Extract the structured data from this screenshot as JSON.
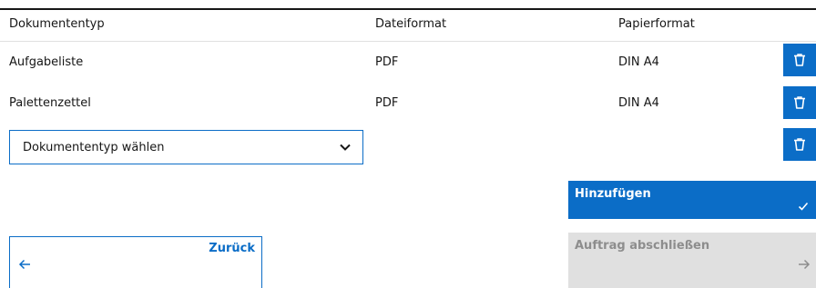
{
  "table": {
    "headers": [
      "Dokumententyp",
      "Dateiformat",
      "Papierformat"
    ],
    "rows": [
      {
        "doc_type": "Aufgabeliste",
        "file_format": "PDF",
        "paper_format": "DIN A4"
      },
      {
        "doc_type": "Palettenzettel",
        "file_format": "PDF",
        "paper_format": "DIN A4"
      }
    ]
  },
  "new_row": {
    "select_placeholder": "Dokumententyp wählen"
  },
  "actions": {
    "add_label": "Hinzufügen",
    "back_label": "Zurück",
    "finish_label": "Auftrag abschließen"
  },
  "icons": {
    "delete": "trash-icon",
    "dropdown": "chevron-down-icon",
    "add": "checkmark-icon",
    "back": "arrow-left-icon",
    "finish": "arrow-right-icon"
  },
  "colors": {
    "primary": "#0b6dc7",
    "text": "#161616",
    "disabled_bg": "#e0e0e0",
    "disabled_text": "#8d8d8d"
  }
}
